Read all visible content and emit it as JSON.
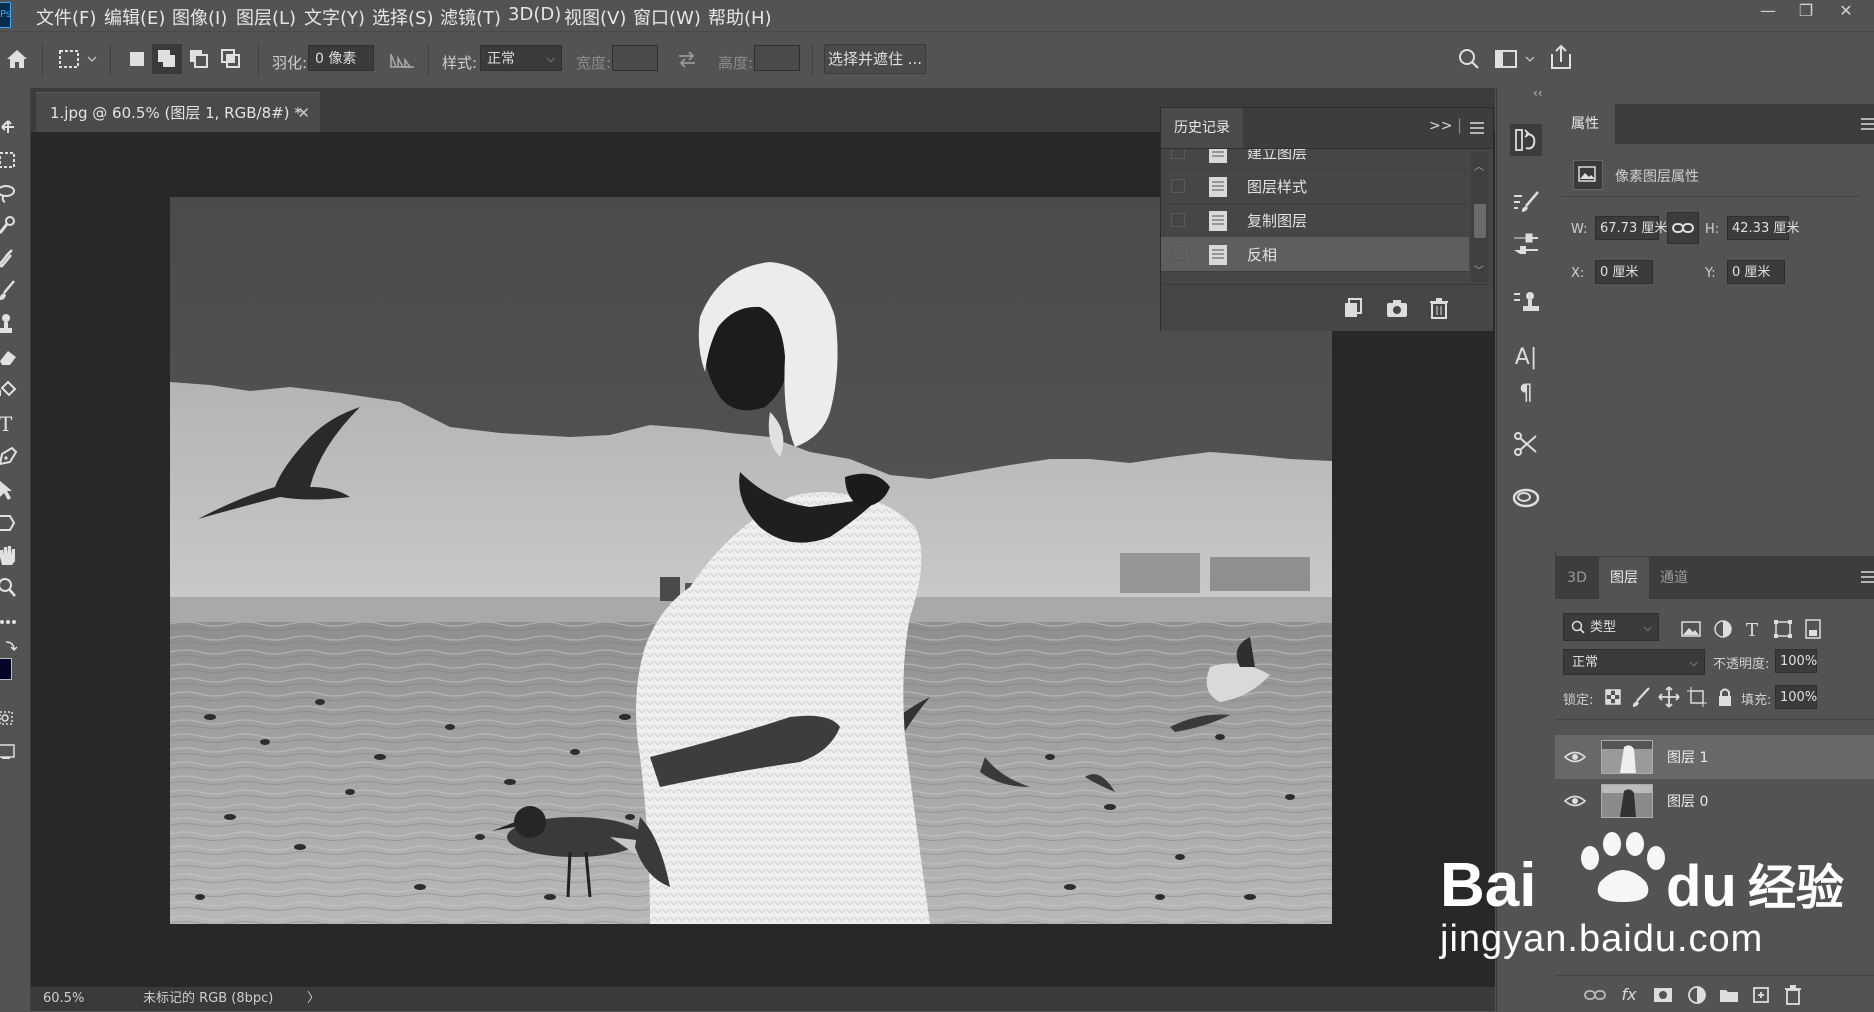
{
  "app": {
    "logo_text": "Ps",
    "menu": [
      "文件(F)",
      "编辑(E)",
      "图像(I)",
      "图层(L)",
      "文字(Y)",
      "选择(S)",
      "滤镜(T)",
      "3D(D)",
      "视图(V)",
      "窗口(W)",
      "帮助(H)"
    ],
    "window_controls": [
      "—",
      "❐",
      "✕"
    ]
  },
  "options": {
    "feather_label": "羽化:",
    "feather_value": "0 像素",
    "style_label": "样式:",
    "style_value": "正常",
    "width_label": "宽度:",
    "height_label": "高度:",
    "select_mask_button": "选择并遮住 ..."
  },
  "document": {
    "tab_title": "1.jpg @ 60.5% (图层 1, RGB/8#) *",
    "tab_close": "✕",
    "zoom": "60.5%",
    "status_text": "未标记的 RGB (8bpc)",
    "status_arrow": "〉"
  },
  "history": {
    "tab_label": "历史记录",
    "expand": ">>",
    "items": [
      {
        "label": "建立图层",
        "active": false
      },
      {
        "label": "图层样式",
        "active": false
      },
      {
        "label": "复制图层",
        "active": false
      },
      {
        "label": "反相",
        "active": true
      }
    ]
  },
  "icon_column": {
    "collapse": "‹‹",
    "items": [
      "history-icon",
      "brush-settings-icon",
      "adjustments-icon",
      "clone-source-icon",
      "character-icon",
      "paragraph-icon",
      "tools-preset-icon",
      "creative-cloud-icon"
    ],
    "character_glyph": "A|",
    "paragraph_glyph": "¶"
  },
  "properties": {
    "tab_label": "属性",
    "section_title": "像素图层属性",
    "w_label": "W:",
    "w_value": "67.73 厘米",
    "h_label": "H:",
    "h_value": "42.33 厘米",
    "x_label": "X:",
    "x_value": "0 厘米",
    "y_label": "Y:",
    "y_value": "0 厘米"
  },
  "layers": {
    "tabs": [
      "3D",
      "图层",
      "通道"
    ],
    "active_tab": "图层",
    "filter_label": "类型",
    "blend_mode": "正常",
    "opacity_label": "不透明度:",
    "opacity_value": "100%",
    "lock_label": "锁定:",
    "fill_label": "填充:",
    "fill_value": "100%",
    "items": [
      {
        "name": "图层 1",
        "selected": true
      },
      {
        "name": "图层 0",
        "selected": false
      }
    ],
    "fx_label": "fx"
  },
  "watermark": {
    "logo_text": "Bai  经验",
    "url": "jingyan.baidu.com"
  }
}
